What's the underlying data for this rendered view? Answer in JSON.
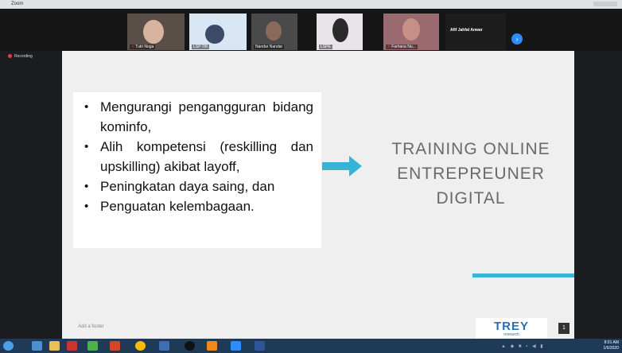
{
  "window": {
    "title": "Zoom"
  },
  "participants": [
    {
      "name": "Tutri Noga"
    },
    {
      "name": "LSP TIK"
    },
    {
      "name": "Nandar Nandar"
    },
    {
      "name": "LSPE"
    },
    {
      "name": "Farhana Nu..."
    },
    {
      "name": "Afif Jahfal Anwar"
    }
  ],
  "recording": {
    "label": "Recording"
  },
  "slide": {
    "bullets": [
      "Mengurangi pengangguran bidang kominfo,",
      "Alih kompetensi (reskilling dan upskilling) akibat layoff,",
      "Peningkatan daya saing, dan",
      "Penguatan kelembagaan."
    ],
    "title_lines": [
      "TRAINING ONLINE",
      "ENTREPREUNER",
      "DIGITAL"
    ],
    "footer": "Add a footer",
    "logo_main": "TREY",
    "logo_sub": "research",
    "page_number": "1"
  },
  "taskbar": {
    "time": "8:01 AM",
    "date": "1/6/2020"
  },
  "colors": {
    "accent_cyan": "#36b4d6",
    "zoom_blue": "#2d8cff",
    "taskbar": "#1e3a56"
  }
}
